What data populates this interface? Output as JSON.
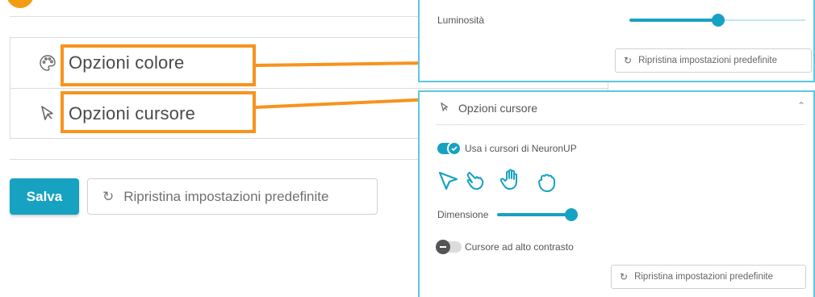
{
  "main": {
    "color_options_label": "Opzioni colore",
    "cursor_options_label": "Opzioni cursore",
    "save_label": "Salva",
    "reset_label": "Ripristina impostazioni predefinite"
  },
  "color_panel": {
    "brightness_label": "Luminosità",
    "brightness_level": 0.5,
    "reset_label": "Ripristina impostazioni predefinite"
  },
  "cursor_panel": {
    "title": "Opzioni cursore",
    "use_cursors_label": "Usa i cursori di NeuronUP",
    "use_cursors_on": true,
    "cursor_icons": [
      "arrow-cursor-icon",
      "pointing-hand-cursor-icon",
      "open-hand-cursor-icon",
      "grab-hand-cursor-icon"
    ],
    "size_label": "Dimensione",
    "size_level": 1.0,
    "high_contrast_label": "Cursore ad alto contrasto",
    "high_contrast_on": false,
    "reset_label": "Ripristina impostazioni predefinite"
  },
  "colors": {
    "accent": "#17a2c2",
    "callout": "#f7931e",
    "panel_border": "#5bc8e0"
  }
}
